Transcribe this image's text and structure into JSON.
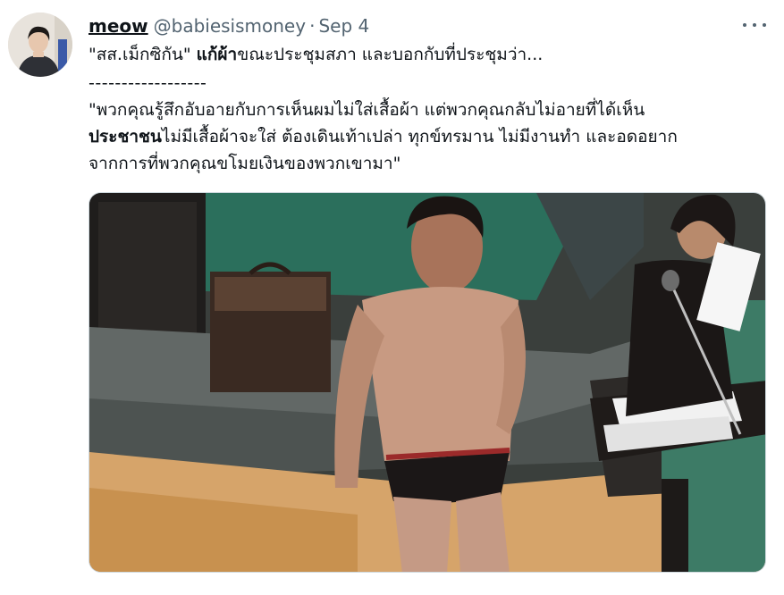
{
  "tweet": {
    "display_name": "meow",
    "handle": "@babiesismoney",
    "separator": "·",
    "date": "Sep 4",
    "line1_part1": "\"สส.เม็กซิกัน\" ",
    "line1_bold": "แก้ผ้า",
    "line1_part2": "ขณะประชุมสภา และบอกกับที่ประชุมว่า...",
    "line2": "------------------",
    "line3": "\"พวกคุณรู้สึกอับอายกับการเห็นผมไม่ใส่เสื้อผ้า แต่พวกคุณกลับไม่อายที่ได้เห็น",
    "line4_bold": "ประชาชน",
    "line4_rest": "ไม่มีเสื้อผ้าจะใส่ ต้องเดินเท้าเปล่า ทุกข์ทรมาน ไม่มีงานทำ และอดอยาก",
    "line5": "จากการที่พวกคุณขโมยเงินของพวกเขามา\""
  },
  "icons": {
    "more": "more-horizontal-icon"
  },
  "colors": {
    "text": "#0f1419",
    "secondary": "#536471",
    "border": "#cfd9de"
  }
}
